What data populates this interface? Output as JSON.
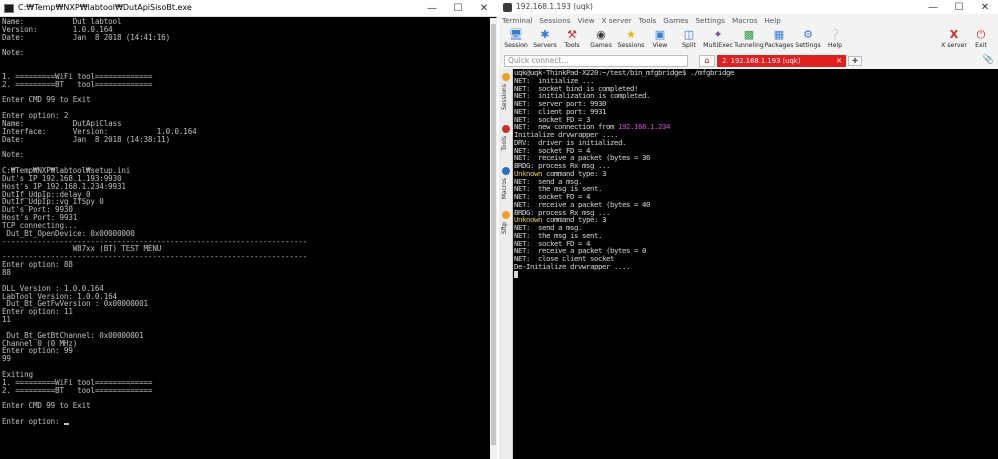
{
  "cmd_window": {
    "title": "C:₩Temp₩NXP₩labtool₩DutApiSisoBt.exe",
    "lines": [
      "Name:           Dut labtool",
      "Version:        1.0.0.164",
      "Date:           Jan  8 2018 (14:41:16)",
      "",
      "Note:",
      "",
      "",
      "1. =========WiFi tool=============",
      "2. =========BT   tool=============",
      "",
      "Enter CMD 99 to Exit",
      "",
      "Enter option: 2",
      "Name:           DutApiClass",
      "Interface:      Version:           1.0.0.164",
      "Date:           Jan  8 2018 (14:38:11)",
      "",
      "Note:",
      "",
      "C:₩Temp₩NXP₩labtool₩setup.ini",
      "Dut's IP 192.168.1.193:9930",
      "Host's IP 192.168.1.234:9931",
      "DutIf_UdpIp::delay 0",
      "DutIf_UdpIp::vg_IfSpy 0",
      "Dut's Port: 9930",
      "Host's Port: 9931",
      "TCP connecting...",
      " Dut_Bt_OpenDevice: 0x00000000",
      "---------------------------------------------------------------------",
      "                W87xx (BT) TEST MENU",
      "---------------------------------------------------------------------",
      "Enter option: 88",
      "88",
      "",
      "DLL Version : 1.0.0.164",
      "LabTool Version: 1.0.0.164",
      " Dut_Bt_GetFwVersion : 0x00000001",
      "Enter option: 11",
      "11",
      "",
      " Dut_Bt_GetBtChannel: 0x00000001",
      "Channel 0 (0 MHz)",
      "Enter option: 99",
      "99",
      "",
      "Exiting",
      "1. =========WiFi tool=============",
      "2. =========BT   tool=============",
      "",
      "Enter CMD 99 to Exit",
      "",
      "Enter option: "
    ]
  },
  "moba_window": {
    "title": "192.168.1.193 (uqk)",
    "menu": [
      "Terminal",
      "Sessions",
      "View",
      "X server",
      "Tools",
      "Games",
      "Settings",
      "Macros",
      "Help"
    ],
    "toolbar": [
      "Session",
      "Servers",
      "Tools",
      "Games",
      "Sessions",
      "View",
      "Split",
      "MultiExec",
      "Tunneling",
      "Packages",
      "Settings",
      "Help"
    ],
    "toolbar_right": [
      "X server",
      "Exit"
    ],
    "quick_connect_placeholder": "Quick connect...",
    "tab_label": "2. 192.168.1.193 (uqk)",
    "side_tabs": [
      "Sessions",
      "Tools",
      "Macros",
      "Sftp"
    ],
    "terminal_lines": [
      [
        {
          "t": "uqk@uqk-ThinkPad-X220:~/test/bin_mfgbridge$ ./mfgbridge",
          "c": "w"
        }
      ],
      [
        {
          "t": "NET:  initialize ...",
          "c": "w"
        }
      ],
      [
        {
          "t": "NET:  socket bind is completed!",
          "c": "w"
        }
      ],
      [
        {
          "t": "NET:  initialization is completed.",
          "c": "w"
        }
      ],
      [
        {
          "t": "NET:  server port: 9930",
          "c": "w"
        }
      ],
      [
        {
          "t": "NET:  client port: 9931",
          "c": "w"
        }
      ],
      [
        {
          "t": "NET:  socket FD = 3",
          "c": "w"
        }
      ],
      [
        {
          "t": "NET:  new connection from ",
          "c": "w"
        },
        {
          "t": "192.168.1.234",
          "c": "m"
        }
      ],
      [
        {
          "t": "Initialize drvwrapper ....",
          "c": "w"
        }
      ],
      [
        {
          "t": "DRV:  driver is initialized.",
          "c": "w"
        }
      ],
      [
        {
          "t": "NET:  socket FD = 4",
          "c": "w"
        }
      ],
      [
        {
          "t": "NET:  receive a packet (bytes = 36",
          "c": "w"
        }
      ],
      [
        {
          "t": "BRDG: process Rx msg ...",
          "c": "w"
        }
      ],
      [
        {
          "t": "Unknown",
          "c": "y"
        },
        {
          "t": " command type: 3",
          "c": "w"
        }
      ],
      [
        {
          "t": "NET:  send a msg.",
          "c": "w"
        }
      ],
      [
        {
          "t": "NET:  the msg is sent.",
          "c": "w"
        }
      ],
      [
        {
          "t": "NET:  socket FD = 4",
          "c": "w"
        }
      ],
      [
        {
          "t": "NET:  receive a packet (bytes = 40",
          "c": "w"
        }
      ],
      [
        {
          "t": "BRDG: process Rx msg ...",
          "c": "w"
        }
      ],
      [
        {
          "t": "Unknown",
          "c": "y"
        },
        {
          "t": " command type: 3",
          "c": "w"
        }
      ],
      [
        {
          "t": "NET:  send a msg.",
          "c": "w"
        }
      ],
      [
        {
          "t": "NET:  the msg is sent.",
          "c": "w"
        }
      ],
      [
        {
          "t": "NET:  socket FD = 4",
          "c": "w"
        }
      ],
      [
        {
          "t": "NET:  receive a packet (bytes = 0",
          "c": "w"
        }
      ],
      [
        {
          "t": "NET:  close client socket",
          "c": "w"
        }
      ],
      [
        {
          "t": "De-Initialize drvwrapper ....",
          "c": "w"
        }
      ]
    ],
    "colors": {
      "text": "#d7d7d7",
      "ip_magenta": "#d24bd2",
      "unknown_yellow": "#e6c84a",
      "tab_red": "#e02020"
    }
  }
}
